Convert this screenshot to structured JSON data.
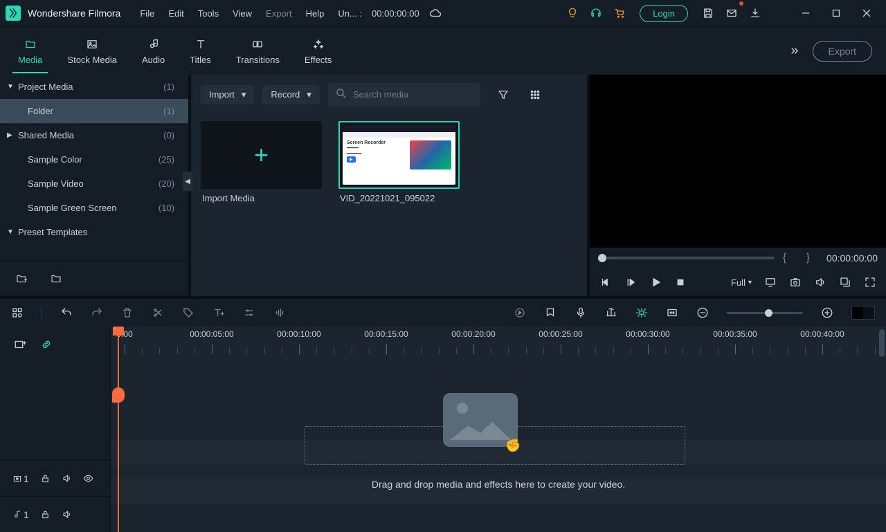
{
  "app": {
    "title": "Wondershare Filmora"
  },
  "menus": [
    "File",
    "Edit",
    "Tools",
    "View",
    "Export",
    "Help"
  ],
  "project_label": "Un... :",
  "project_time": "00:00:00:00",
  "login": "Login",
  "tabs": [
    {
      "label": "Media",
      "icon": "folder-icon",
      "active": true
    },
    {
      "label": "Stock Media",
      "icon": "image-icon"
    },
    {
      "label": "Audio",
      "icon": "music-icon"
    },
    {
      "label": "Titles",
      "icon": "text-icon"
    },
    {
      "label": "Transitions",
      "icon": "transition-icon"
    },
    {
      "label": "Effects",
      "icon": "sparkle-icon"
    }
  ],
  "export_btn": "Export",
  "sidebar": [
    {
      "name": "Project Media",
      "count": "(1)",
      "level": 0,
      "expand": "down"
    },
    {
      "name": "Folder",
      "count": "(1)",
      "level": 1,
      "selected": true
    },
    {
      "name": "Shared Media",
      "count": "(0)",
      "level": 0,
      "expand": "right"
    },
    {
      "name": "Sample Color",
      "count": "(25)",
      "level": 1
    },
    {
      "name": "Sample Video",
      "count": "(20)",
      "level": 1
    },
    {
      "name": "Sample Green Screen",
      "count": "(10)",
      "level": 1
    },
    {
      "name": "Preset Templates",
      "count": "",
      "level": 0,
      "expand": "down"
    }
  ],
  "browser": {
    "import_btn": "Import",
    "record_btn": "Record",
    "search_placeholder": "Search media",
    "import_tile": "Import Media",
    "clip_name": "VID_20221021_095022",
    "fake_title": "Screen Recorder"
  },
  "preview": {
    "brackets": "{  }",
    "time": "00:00:00:00",
    "quality": "Full"
  },
  "ruler": {
    "labels": [
      "0:00",
      "00:00:05:00",
      "00:00:10:00",
      "00:00:15:00",
      "00:00:20:00",
      "00:00:25:00",
      "00:00:30:00",
      "00:00:35:00",
      "00:00:40:00"
    ],
    "step": 126
  },
  "tracks": {
    "video_num": "1",
    "audio_num": "1",
    "drop_text": "Drag and drop media and effects here to create your video."
  }
}
